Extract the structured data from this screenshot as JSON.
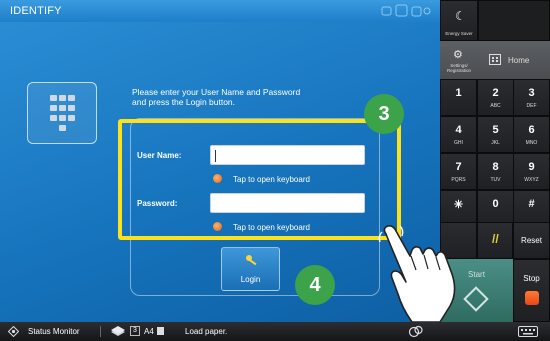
{
  "screen": {
    "title": "IDENTIFY",
    "instruction_line1": "Please enter your User Name and Password",
    "instruction_line2": "and press the Login button.",
    "username_label": "User Name:",
    "username_value": "",
    "password_label": "Password:",
    "password_value": "",
    "keyboard_hint": "Tap to open keyboard",
    "login_label": "Login"
  },
  "annotations": {
    "step3": "3",
    "step4": "4",
    "highlight_color": "#ffe11a",
    "badge_color": "#3ca34a"
  },
  "statusbar": {
    "status_monitor": "Status Monitor",
    "tray_number": "3",
    "paper_size": "A4",
    "message": "Load paper."
  },
  "panel": {
    "energy_saver": "Energy Saver",
    "settings_label": "Settings/ Registration",
    "home_label": "Home",
    "keys": [
      {
        "digit": "1",
        "letters": ""
      },
      {
        "digit": "2",
        "letters": "ABC"
      },
      {
        "digit": "3",
        "letters": "DEF"
      },
      {
        "digit": "4",
        "letters": "GHI"
      },
      {
        "digit": "5",
        "letters": "JKL"
      },
      {
        "digit": "6",
        "letters": "MNO"
      },
      {
        "digit": "7",
        "letters": "PQRS"
      },
      {
        "digit": "8",
        "letters": "TUV"
      },
      {
        "digit": "9",
        "letters": "WXYZ"
      },
      {
        "digit": "✳",
        "letters": ""
      },
      {
        "digit": "0",
        "letters": ""
      },
      {
        "digit": "#",
        "letters": ""
      }
    ],
    "reset_label": "Reset",
    "start_label": "Start",
    "stop_label": "Stop",
    "start_color": "#3b7e74",
    "stop_color": "#e8471a"
  }
}
